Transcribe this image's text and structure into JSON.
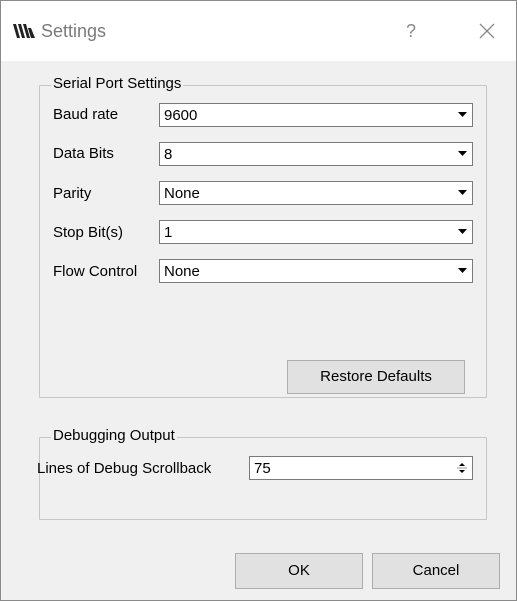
{
  "window": {
    "title": "Settings",
    "help_glyph": "?",
    "icons": {
      "app": "app-logo-icon",
      "close": "close-icon"
    }
  },
  "serial_port": {
    "group_title": "Serial Port Settings",
    "fields": [
      {
        "label": "Baud rate",
        "value": "9600"
      },
      {
        "label": "Data Bits",
        "value": "8"
      },
      {
        "label": "Parity",
        "value": "None"
      },
      {
        "label": "Stop Bit(s)",
        "value": "1"
      },
      {
        "label": "Flow Control",
        "value": "None"
      }
    ],
    "restore_defaults_label": "Restore Defaults"
  },
  "debugging": {
    "group_title": "Debugging Output",
    "scrollback_label": "Lines of Debug Scrollback",
    "scrollback_value": "75"
  },
  "buttons": {
    "ok": "OK",
    "cancel": "Cancel"
  }
}
